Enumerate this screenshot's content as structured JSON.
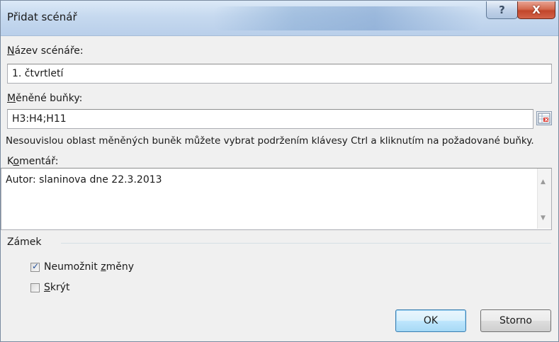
{
  "window": {
    "title": "Přidat scénář",
    "help_glyph": "?",
    "close_glyph": "X"
  },
  "scenario_name": {
    "label_accel": "N",
    "label_rest": "ázev scénáře:",
    "value": "1. čtvrtletí"
  },
  "changing_cells": {
    "label_accel": "M",
    "label_rest": "ěněné buňky:",
    "value": "H3:H4;H11",
    "hint": "Nesouvislou oblast měněných buněk můžete vybrat podržením klávesy Ctrl a kliknutím na požadované buňky."
  },
  "comment": {
    "label_pre": "K",
    "label_accel": "o",
    "label_rest": "mentář:",
    "value": "Autor: slaninova dne 22.3.2013",
    "scroll_up_glyph": "▲",
    "scroll_down_glyph": "▼"
  },
  "protection": {
    "group_label": "Zámek",
    "prevent_changes": {
      "label_pre": "Neumožnit ",
      "label_accel": "z",
      "label_rest": "měny",
      "checked": true,
      "check_glyph": "✓"
    },
    "hide": {
      "label_accel": "S",
      "label_rest": "krýt",
      "checked": false
    }
  },
  "buttons": {
    "ok": "OK",
    "cancel": "Storno"
  },
  "colors": {
    "accent": "#3c7fb1",
    "close": "#c2462b"
  }
}
